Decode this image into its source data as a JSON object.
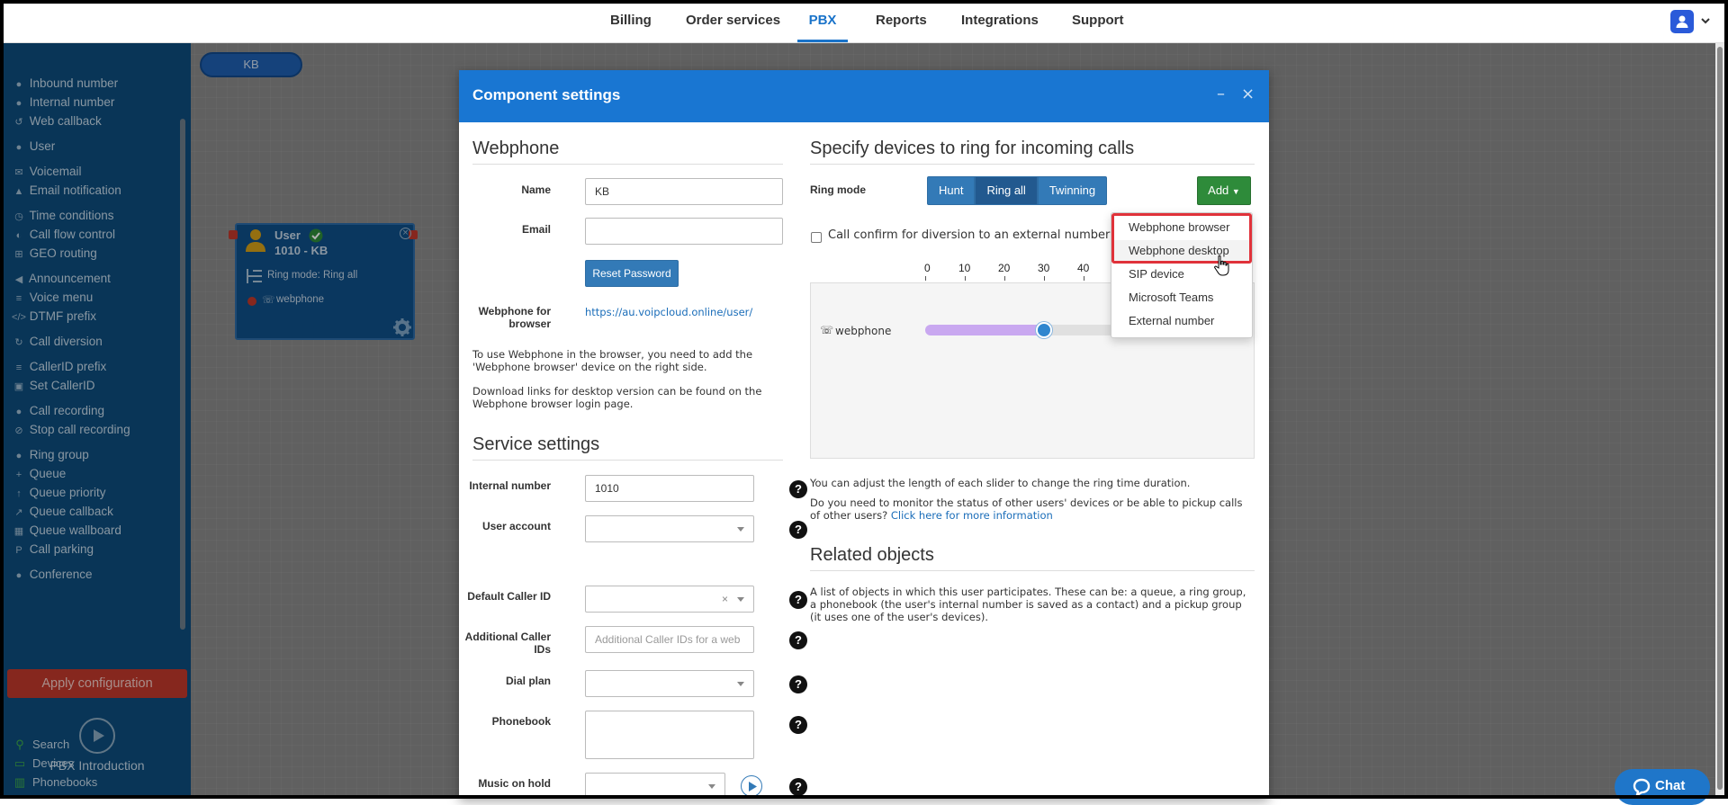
{
  "nav": {
    "tabs": [
      {
        "label": "Billing"
      },
      {
        "label": "Order services"
      },
      {
        "label": "PBX"
      },
      {
        "label": "Reports"
      },
      {
        "label": "Integrations"
      },
      {
        "label": "Support"
      }
    ],
    "active_tab": "PBX"
  },
  "sidebar": {
    "items": [
      {
        "label": "Inbound number",
        "icon": "phone-icon"
      },
      {
        "label": "Internal number",
        "icon": "map-pin-icon"
      },
      {
        "label": "Web callback",
        "icon": "undo-icon"
      },
      {
        "label": "User",
        "icon": "user-icon"
      },
      {
        "label": "Voicemail",
        "icon": "envelope-icon"
      },
      {
        "label": "Email notification",
        "icon": "bell-icon"
      },
      {
        "label": "Time conditions",
        "icon": "clock-icon"
      },
      {
        "label": "Call flow control",
        "icon": "toggle-icon"
      },
      {
        "label": "GEO routing",
        "icon": "sitemap-icon"
      },
      {
        "label": "Announcement",
        "icon": "megaphone-icon"
      },
      {
        "label": "Voice menu",
        "icon": "list-icon"
      },
      {
        "label": "DTMF prefix",
        "icon": "code-icon"
      },
      {
        "label": "Call diversion",
        "icon": "redo-icon"
      },
      {
        "label": "CallerID prefix",
        "icon": "list-icon"
      },
      {
        "label": "Set CallerID",
        "icon": "id-card-icon"
      },
      {
        "label": "Call recording",
        "icon": "microphone-icon"
      },
      {
        "label": "Stop call recording",
        "icon": "microphone-slash-icon"
      },
      {
        "label": "Ring group",
        "icon": "users-icon"
      },
      {
        "label": "Queue",
        "icon": "user-plus-icon"
      },
      {
        "label": "Queue priority",
        "icon": "arrow-up-icon"
      },
      {
        "label": "Queue callback",
        "icon": "share-icon"
      },
      {
        "label": "Queue wallboard",
        "icon": "table-icon"
      },
      {
        "label": "Call parking",
        "icon": "parking-icon"
      },
      {
        "label": "Conference",
        "icon": "comments-icon"
      }
    ],
    "apply_label": "Apply configuration",
    "intro_label": "PBX Introduction",
    "bottom_links": [
      {
        "label": "Search",
        "icon": "search-icon"
      },
      {
        "label": "Devices",
        "icon": "monitor-icon"
      },
      {
        "label": "Phonebooks",
        "icon": "book-icon"
      }
    ]
  },
  "canvas": {
    "chip_label": "KB",
    "node": {
      "title": "User",
      "subtitle": "1010 - KB",
      "ring_mode": "Ring mode: Ring all",
      "device": "webphone"
    }
  },
  "modal": {
    "title": "Component settings",
    "webphone": {
      "section_title": "Webphone",
      "name_label": "Name",
      "name_value": "KB",
      "email_label": "Email",
      "email_value": "",
      "reset_password_label": "Reset Password",
      "browser_label": "Webphone for browser",
      "browser_url": "https://au.voipcloud.online/user/",
      "note1": "To use Webphone in the browser, you need to add the 'Webphone browser' device on the right side.",
      "note2": "Download links for desktop version can be found on the Webphone browser login page."
    },
    "service": {
      "section_title": "Service settings",
      "internal_number_label": "Internal number",
      "internal_number_value": "1010",
      "user_account_label": "User account",
      "default_caller_id_label": "Default Caller ID",
      "additional_caller_ids_label": "Additional Caller IDs",
      "additional_caller_ids_placeholder": "Additional Caller IDs for a web",
      "dial_plan_label": "Dial plan",
      "phonebook_label": "Phonebook",
      "music_on_hold_label": "Music on hold"
    },
    "devices": {
      "section_title": "Specify devices to ring for incoming calls",
      "ring_mode_label": "Ring mode",
      "ring_modes": [
        "Hunt",
        "Ring all",
        "Twinning"
      ],
      "ring_mode_selected": "Ring all",
      "add_label": "Add",
      "call_confirm_label": "Call confirm for diversion to an external number",
      "call_confirm_checked": false,
      "ticks": [
        "0",
        "10",
        "20",
        "30",
        "40"
      ],
      "device_name": "webphone",
      "device_ring_seconds": 30,
      "slider_note": "You can adjust the length of each slider to change the ring time duration.",
      "monitor_note": "Do you need to monitor the status of other users' devices or be able to pickup calls of other users?",
      "monitor_link": "Click here for more information"
    },
    "add_menu": {
      "items": [
        "Webphone browser",
        "Webphone desktop",
        "SIP device",
        "Microsoft Teams",
        "External number"
      ],
      "hovered": "Webphone desktop"
    },
    "related": {
      "section_title": "Related objects",
      "text": "A list of objects in which this user participates. These can be: a queue, a ring group, a phonebook (the user's internal number is saved as a contact) and a pickup group (it uses one of the user's devices)."
    }
  },
  "chat": {
    "label": "Chat"
  },
  "colors": {
    "accent": "#1976d2",
    "sidebar_bg": "#0e4d7d",
    "apply_bg": "#c0392b",
    "add_bg": "#2e8b3a",
    "highlight": "#e0323a",
    "slider_fill": "#c9a8f0"
  }
}
